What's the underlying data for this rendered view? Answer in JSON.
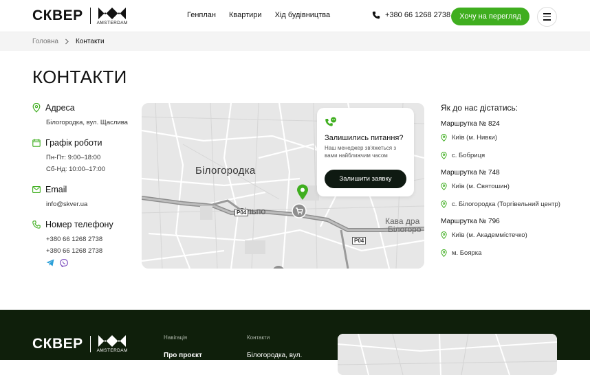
{
  "header": {
    "logo_word": "СКВЕР",
    "logo_sub": "AMSTERDAM",
    "nav": [
      "Генплан",
      "Квартири",
      "Хід будівництва"
    ],
    "phone": "+380 66 1268 2738",
    "cta": "Хочу на перегляд"
  },
  "breadcrumb": {
    "home": "Головна",
    "current": "Контакти"
  },
  "page_title": "КОНТАКТИ",
  "contacts": {
    "address": {
      "label": "Адреса",
      "value": "Білогородка, вул. Щаслива"
    },
    "schedule": {
      "label": "Графік роботи",
      "line1": "Пн-Пт: 9:00–18:00",
      "line2": "Сб-Нд: 10:00–17:00"
    },
    "email": {
      "label": "Email",
      "value": "info@skver.ua"
    },
    "phones": {
      "label": "Номер телефону",
      "phone1": "+380 66 1268 2738",
      "phone2": "+380 66 1268 2738"
    }
  },
  "map": {
    "town": "Білогородка",
    "place": "Сільпо",
    "road1": "P04",
    "road2": "P04",
    "cafe": "Кава дра",
    "cafe2": "Білогоро"
  },
  "callback_card": {
    "title": "Залишились питання?",
    "text": "Наш менеджер зв'яжеться з вами найближчим часом",
    "button": "Залишити заявку"
  },
  "routes": {
    "title": "Як до нас дістатись:",
    "items": [
      {
        "name": "Маршрутка № 824",
        "from": "Київ (м. Нивки)",
        "to": "с. Бобриця"
      },
      {
        "name": "Маршрутка № 748",
        "from": "Київ (м. Святошин)",
        "to": "с. Білогородка (Торгівельний центр)"
      },
      {
        "name": "Маршрутка № 796",
        "from": "Київ (м. Академмістечко)",
        "to": "м. Боярка"
      }
    ]
  },
  "footer": {
    "logo_word": "СКВЕР",
    "logo_sub": "AMSTERDAM",
    "nav_label": "Навігація",
    "nav_first": "Про проєкт",
    "contacts_label": "Контакти",
    "contacts_address": "Білогородка, вул. Щаслива"
  },
  "colors": {
    "accent": "#3fae1f",
    "dark": "#0f1f0b",
    "button_dark": "#0f1a12"
  }
}
